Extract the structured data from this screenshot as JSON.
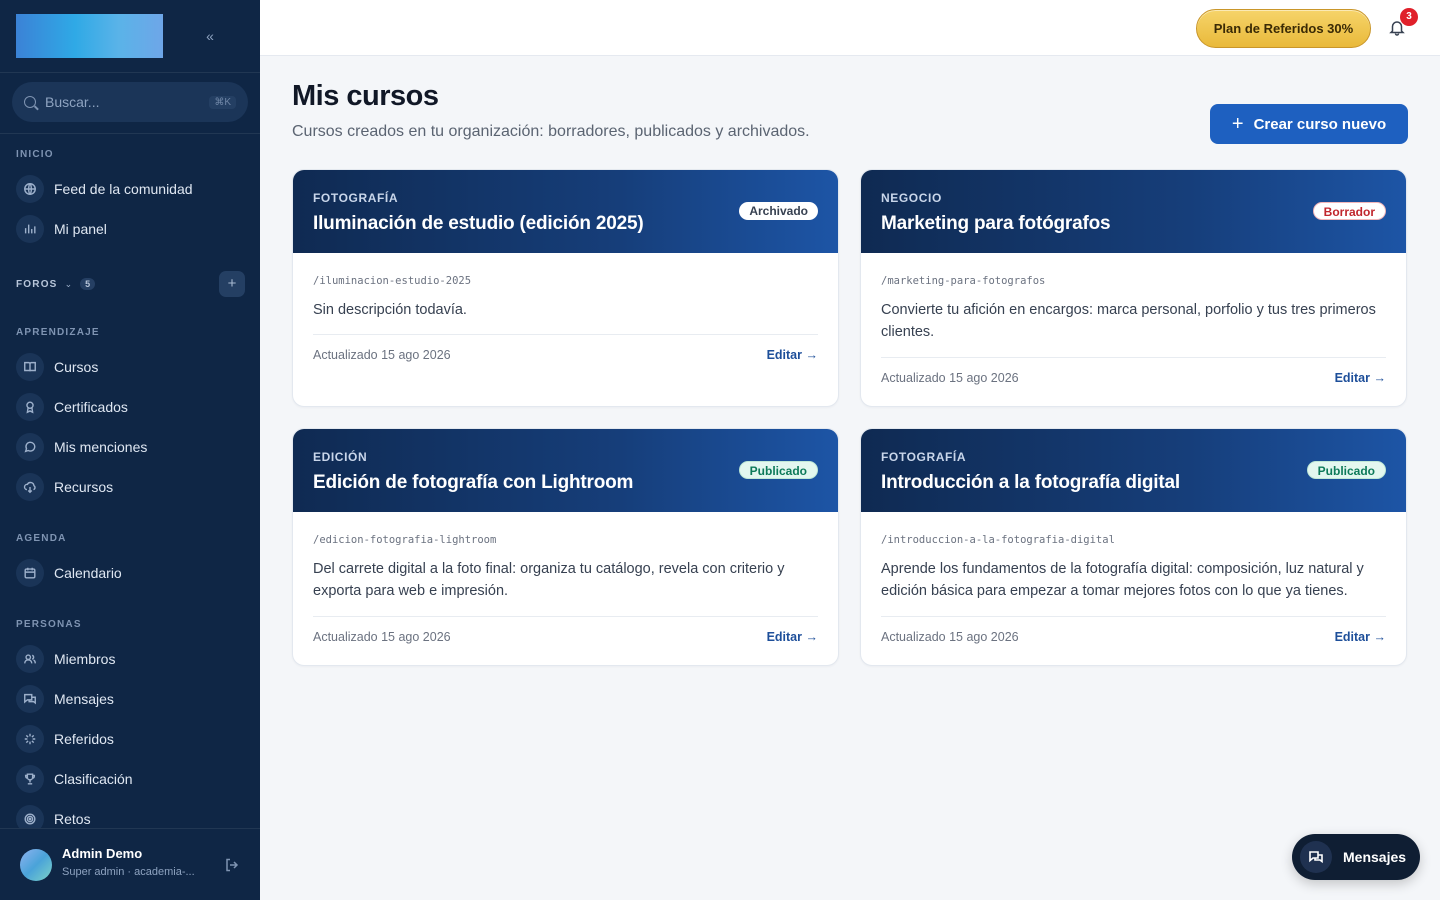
{
  "sidebar": {
    "search_placeholder": "Buscar...",
    "search_shortcut": "⌘K",
    "sections": {
      "inicio": "INICIO",
      "foros": "FOROS",
      "foros_count": "5",
      "aprendizaje": "APRENDIZAJE",
      "agenda": "AGENDA",
      "personas": "PERSONAS"
    },
    "items": {
      "feed": "Feed de la comunidad",
      "panel": "Mi panel",
      "cursos": "Cursos",
      "certificados": "Certificados",
      "menciones": "Mis menciones",
      "recursos": "Recursos",
      "calendario": "Calendario",
      "miembros": "Miembros",
      "mensajes": "Mensajes",
      "referidos": "Referidos",
      "clasificacion": "Clasificación",
      "retos": "Retos"
    },
    "user": {
      "name": "Admin Demo",
      "role": "Super admin · academia-..."
    }
  },
  "topbar": {
    "referral_label": "Plan de Referidos 30%",
    "notification_count": "3"
  },
  "main": {
    "title": "Mis cursos",
    "subtitle": "Cursos creados en tu organización: borradores, publicados y archivados.",
    "create_label": "Crear curso nuevo",
    "cards": [
      {
        "category": "FOTOGRAFÍA",
        "title": "Iluminación de estudio (edición 2025)",
        "status": "Archivado",
        "slug": "/iluminacion-estudio-2025",
        "description": "Sin descripción todavía.",
        "updated": "Actualizado 15 ago 2026",
        "edit": "Editar"
      },
      {
        "category": "NEGOCIO",
        "title": "Marketing para fotógrafos",
        "status": "Borrador",
        "slug": "/marketing-para-fotografos",
        "description": "Convierte tu afición en encargos: marca personal, porfolio y tus tres primeros clientes.",
        "updated": "Actualizado 15 ago 2026",
        "edit": "Editar"
      },
      {
        "category": "EDICIÓN",
        "title": "Edición de fotografía con Lightroom",
        "status": "Publicado",
        "slug": "/edicion-fotografia-lightroom",
        "description": "Del carrete digital a la foto final: organiza tu catálogo, revela con criterio y exporta para web e impresión.",
        "updated": "Actualizado 15 ago 2026",
        "edit": "Editar"
      },
      {
        "category": "FOTOGRAFÍA",
        "title": "Introducción a la fotografía digital",
        "status": "Publicado",
        "slug": "/introduccion-a-la-fotografia-digital",
        "description": "Aprende los fundamentos de la fotografía digital: composición, luz natural y edición básica para empezar a tomar mejores fotos con lo que ya tienes.",
        "updated": "Actualizado 15 ago 2026",
        "edit": "Editar"
      }
    ]
  },
  "fab": {
    "label": "Mensajes"
  }
}
